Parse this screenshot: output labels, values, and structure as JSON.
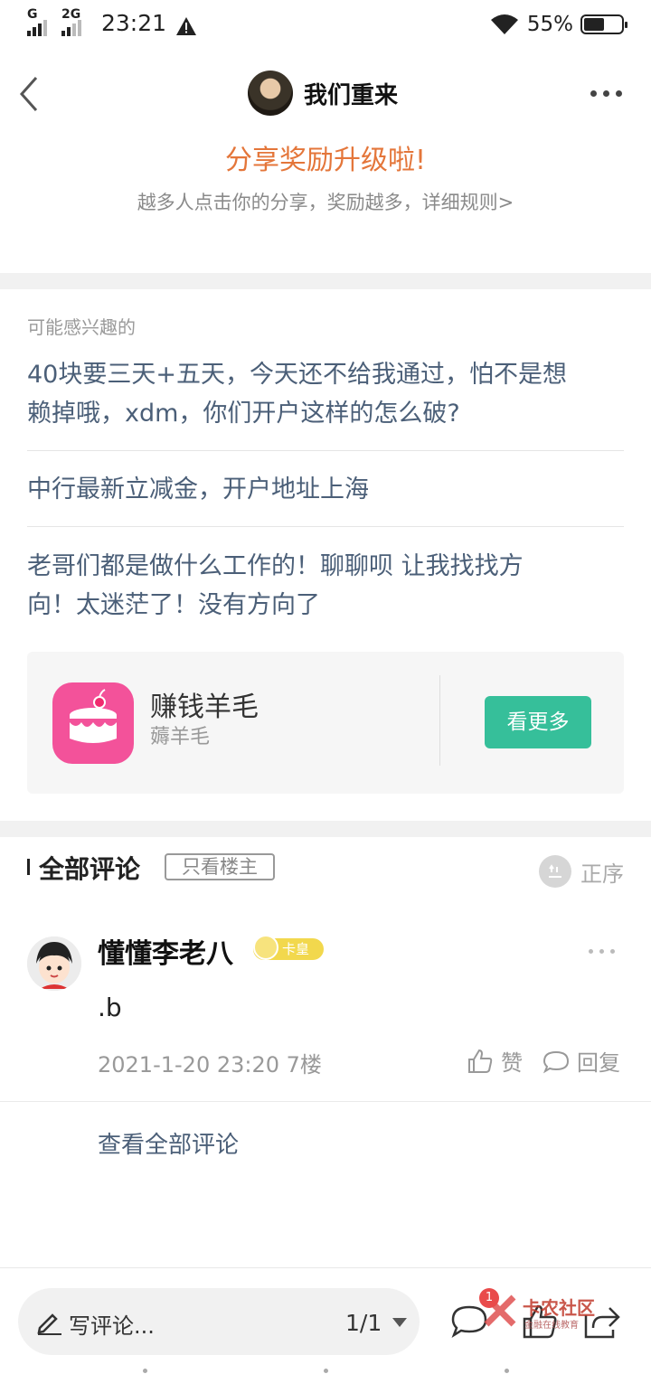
{
  "status_bar": {
    "sim1_label": "G",
    "sim2_label": "2G",
    "time": "23:21",
    "battery_pct": "55%",
    "battery_level": 0.55
  },
  "header": {
    "title": "我们重来",
    "share_title": "分享奖励升级啦!",
    "share_subtitle": "越多人点击你的分享，奖励越多，详细规则>"
  },
  "interest": {
    "label": "可能感兴趣的",
    "items": [
      {
        "line1": "40块要三天+五天，今天还不给我通过，怕不是想",
        "line2": "赖掉哦，xdm，你们开户这样的怎么破?"
      },
      {
        "line1": "中行最新立减金，开户地址上海",
        "line2": ""
      },
      {
        "line1": "老哥们都是做什么工作的！聊聊呗 让我找找方",
        "line2": "向！太迷茫了！没有方向了"
      }
    ]
  },
  "app_card": {
    "name": "赚钱羊毛",
    "subtitle": "薅羊毛",
    "button": "看更多",
    "icon": "cake-icon"
  },
  "comments": {
    "heading": "全部评论",
    "only_owner": "只看楼主",
    "sort_label": "正序",
    "items": [
      {
        "author": "懂懂李老八",
        "badge": "卡皇",
        "text": ".b",
        "time_floor": "2021-1-20 23:20  7楼",
        "like": "赞",
        "reply": "回复"
      }
    ],
    "view_all": "查看全部评论"
  },
  "bottom_bar": {
    "write_label": "写评论...",
    "page_indicator": "1/1",
    "notification_count": "1",
    "watermark_main": "卡农社区",
    "watermark_sub": "金融在线教育"
  },
  "colors": {
    "accent_orange": "#e4763a",
    "link_blue": "#4b5f78",
    "button_green": "#36bf9a",
    "app_pink": "#f3529a"
  }
}
